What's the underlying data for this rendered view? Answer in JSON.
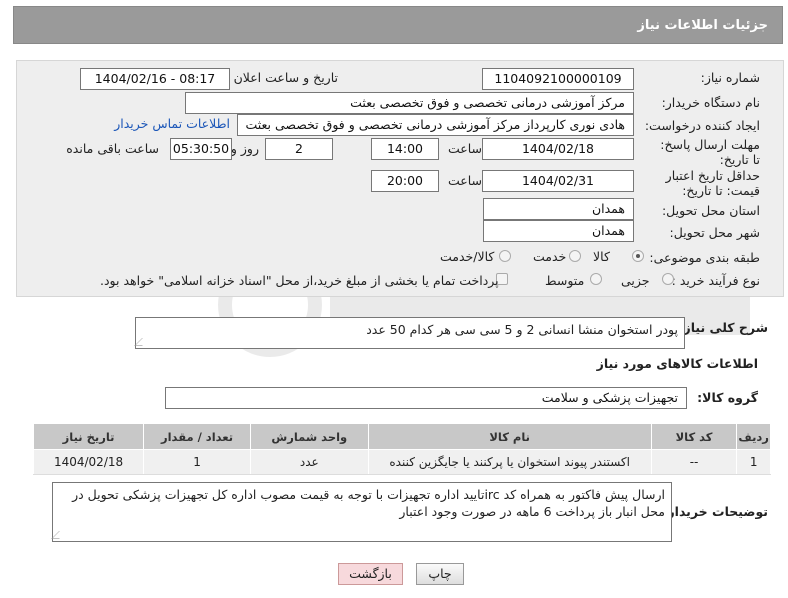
{
  "header": {
    "title": "جزئیات اطلاعات نیاز"
  },
  "fields": {
    "need_number_label": "شماره نیاز:",
    "need_number": "1104092100000109",
    "announce_label": "تاریخ و ساعت اعلان عمومی:",
    "announce_value": "1404/02/16 - 08:17",
    "buyer_org_label": "نام دستگاه خریدار:",
    "buyer_org": "مرکز آموزشی درمانی تخصصی و فوق تخصصی بعثت",
    "requester_label": "ایجاد کننده درخواست:",
    "requester": "هادی نوری کارپرداز مرکز آموزشی درمانی تخصصی و فوق تخصصی بعثت",
    "contact_link": "اطلاعات تماس خریدار",
    "reply_deadline_label": "مهلت ارسال پاسخ: تا تاریخ:",
    "reply_date": "1404/02/18",
    "time_word": "ساعت",
    "reply_time": "14:00",
    "days_value": "2",
    "days_word": "روز و",
    "remaining_time": "05:30:50",
    "remaining_label": "ساعت باقی مانده",
    "price_deadline_label": "حداقل تاریخ اعتبار قیمت: تا تاریخ:",
    "price_date": "1404/02/31",
    "price_time": "20:00",
    "province_label": "استان محل تحویل:",
    "province": "همدان",
    "city_label": "شهر محل تحویل:",
    "city": "همدان",
    "category_label": "طبقه بندی موضوعی:",
    "category_options": [
      "کالا",
      "خدمت",
      "کالا/خدمت"
    ],
    "process_label": "نوع فرآیند خرید :",
    "process_options": [
      "جزیی",
      "متوسط"
    ],
    "payment_note": "پرداخت تمام یا بخشی از مبلغ خرید،از محل \"اسناد خزانه اسلامی\" خواهد بود."
  },
  "description": {
    "label": "شرح کلی نیاز:",
    "text": "پودر استخوان منشا انسانی 2 و 5 سی سی هر کدام 50 عدد"
  },
  "goods_section": {
    "title": "اطلاعات کالاهای مورد نیاز",
    "group_label": "گروه کالا:",
    "group_value": "تجهیزات پزشکی و سلامت",
    "columns": [
      "ردیف",
      "کد کالا",
      "نام کالا",
      "واحد شمارش",
      "تعداد / مقدار",
      "تاریخ نیاز"
    ],
    "rows": [
      [
        "1",
        "--",
        "اکستندر پیوند استخوان یا پرکنند یا جایگزین کننده",
        "عدد",
        "1",
        "1404/02/18"
      ]
    ]
  },
  "buyer_notes": {
    "label": "توضیحات خریدار:",
    "text": "ارسال پیش فاکتور به همراه کد ircتایید اداره تجهیزات  با توجه به قیمت مصوب اداره کل تجهیزات پزشکی تحویل در محل انبار باز پرداخت 6 ماهه در صورت وجود اعتبار"
  },
  "buttons": {
    "print": "چاپ",
    "back": "بازگشت"
  }
}
